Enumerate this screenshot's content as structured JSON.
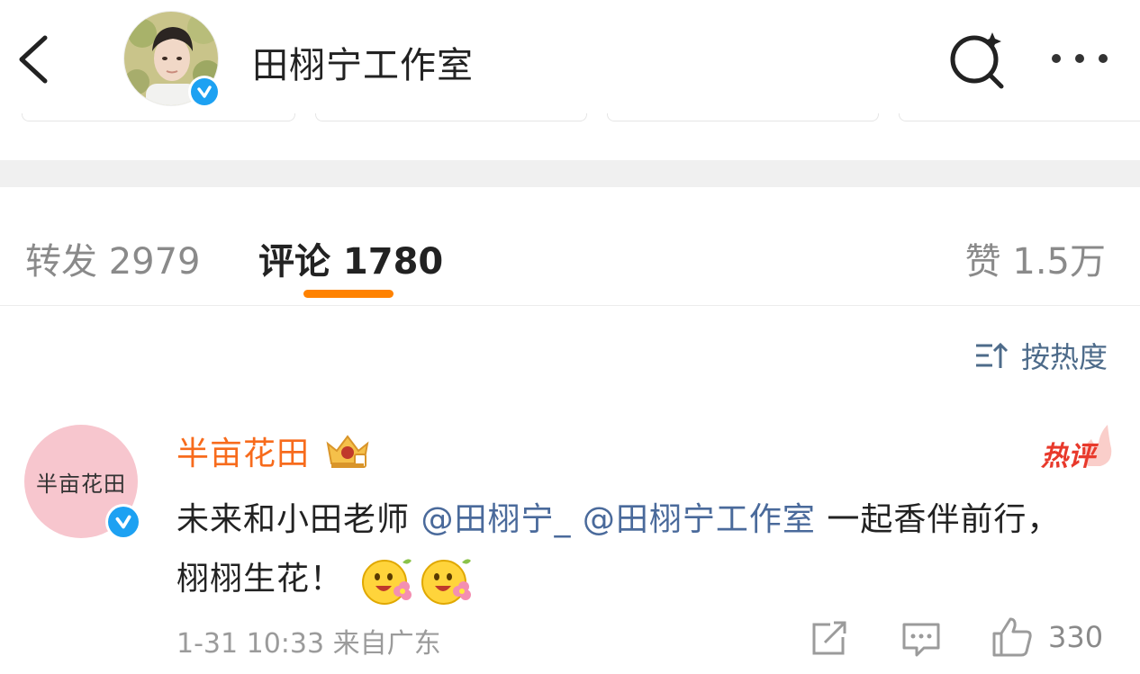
{
  "header": {
    "title": "田栩宁工作室",
    "back_icon": "chevron-left-icon",
    "search_icon": "search-sparkle-icon",
    "more_icon": "more-dots-icon",
    "verified_color": "#1da1f2"
  },
  "tabs": {
    "forward": "转发 2979",
    "comment": "评论 1780",
    "like": "赞 1.5万",
    "active_color": "#ff8200"
  },
  "sort": {
    "label": "按热度",
    "icon": "sort-icon"
  },
  "comment": {
    "avatar_text": "半亩花田",
    "user_name": "半亩花田",
    "name_color": "#f76b1c",
    "hot_label": "热评",
    "text_before": "未来和小田老师 ",
    "mention1": "@田栩宁_",
    "mention2": "@田栩宁工作室",
    "text_after": " 一起香伴前行，栩栩生花！",
    "meta": "1-31 10:33  来自广东",
    "like_count": "330"
  }
}
